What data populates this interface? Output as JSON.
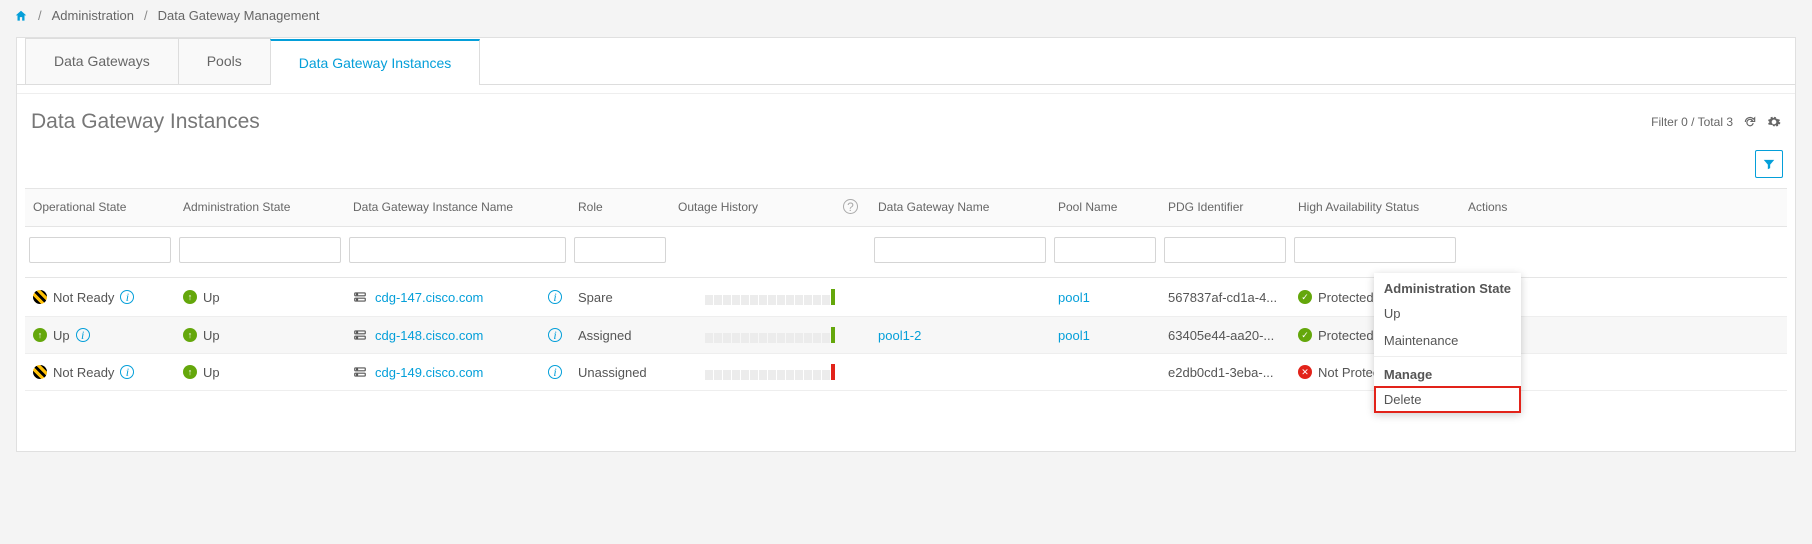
{
  "breadcrumb": {
    "admin": "Administration",
    "page": "Data Gateway Management"
  },
  "tabs": {
    "gateways": "Data Gateways",
    "pools": "Pools",
    "instances": "Data Gateway Instances"
  },
  "section": {
    "title": "Data Gateway Instances",
    "meta": "Filter 0 / Total 3"
  },
  "columns": {
    "op_state": "Operational State",
    "admin_state": "Administration State",
    "inst_name": "Data Gateway Instance Name",
    "role": "Role",
    "outage": "Outage History",
    "gw_name": "Data Gateway Name",
    "pool_name": "Pool Name",
    "pdg_id": "PDG Identifier",
    "ha_status": "High Availability Status",
    "actions": "Actions"
  },
  "rows": [
    {
      "op": "Not Ready",
      "opkind": "warn",
      "admin": "Up",
      "inst": "cdg-147.cisco.com",
      "role": "Spare",
      "outage_lead": "green",
      "gw": "",
      "pool": "pool1",
      "pdg": "567837af-cd1a-4...",
      "ha": "Protected",
      "hakind": "ok"
    },
    {
      "op": "Up",
      "opkind": "up",
      "admin": "Up",
      "inst": "cdg-148.cisco.com",
      "role": "Assigned",
      "outage_lead": "green",
      "gw": "pool1-2",
      "pool": "pool1",
      "pdg": "63405e44-aa20-...",
      "ha": "Protected",
      "hakind": "ok"
    },
    {
      "op": "Not Ready",
      "opkind": "warn",
      "admin": "Up",
      "inst": "cdg-149.cisco.com",
      "role": "Unassigned",
      "outage_lead": "red",
      "gw": "",
      "pool": "",
      "pdg": "e2db0cd1-3eba-...",
      "ha": "Not Protected",
      "hakind": "bad"
    }
  ],
  "menu": {
    "header1": "Administration State",
    "up": "Up",
    "maint": "Maintenance",
    "header2": "Manage",
    "delete": "Delete"
  }
}
